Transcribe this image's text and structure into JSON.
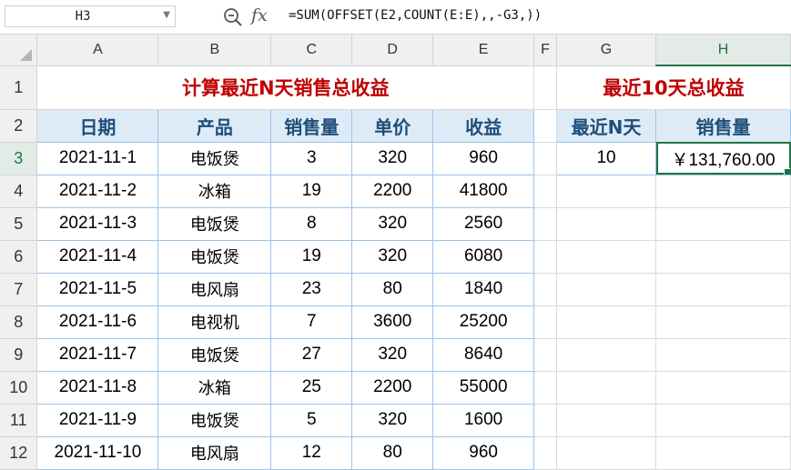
{
  "formula_bar": {
    "name_box": "H3",
    "fx_label": "fx",
    "formula": "=SUM(OFFSET(E2,COUNT(E:E),,-G3,))"
  },
  "columns": [
    "A",
    "B",
    "C",
    "D",
    "E",
    "F",
    "G",
    "H"
  ],
  "rows": [
    "1",
    "2",
    "3",
    "4",
    "5",
    "6",
    "7",
    "8",
    "9",
    "10",
    "11",
    "12"
  ],
  "sheet": {
    "title_left": "计算最近N天销售总收益",
    "title_right": "最近10天总收益",
    "headers": [
      "日期",
      "产品",
      "销售量",
      "单价",
      "收益"
    ],
    "data": [
      [
        "2021-11-1",
        "电饭煲",
        "3",
        "320",
        "960"
      ],
      [
        "2021-11-2",
        "冰箱",
        "19",
        "2200",
        "41800"
      ],
      [
        "2021-11-3",
        "电饭煲",
        "8",
        "320",
        "2560"
      ],
      [
        "2021-11-4",
        "电饭煲",
        "19",
        "320",
        "6080"
      ],
      [
        "2021-11-5",
        "电风扇",
        "23",
        "80",
        "1840"
      ],
      [
        "2021-11-6",
        "电视机",
        "7",
        "3600",
        "25200"
      ],
      [
        "2021-11-7",
        "电饭煲",
        "27",
        "320",
        "8640"
      ],
      [
        "2021-11-8",
        "冰箱",
        "25",
        "2200",
        "55000"
      ],
      [
        "2021-11-9",
        "电饭煲",
        "5",
        "320",
        "1600"
      ],
      [
        "2021-11-10",
        "电风扇",
        "12",
        "80",
        "960"
      ]
    ],
    "right_headers": [
      "最近N天",
      "销售量"
    ],
    "right_values": [
      "10",
      "￥131,760.00"
    ]
  },
  "colors": {
    "title_red": "#c00000",
    "header_fill": "#ddebf7",
    "header_text": "#1f4e79",
    "selection_green": "#217346"
  }
}
